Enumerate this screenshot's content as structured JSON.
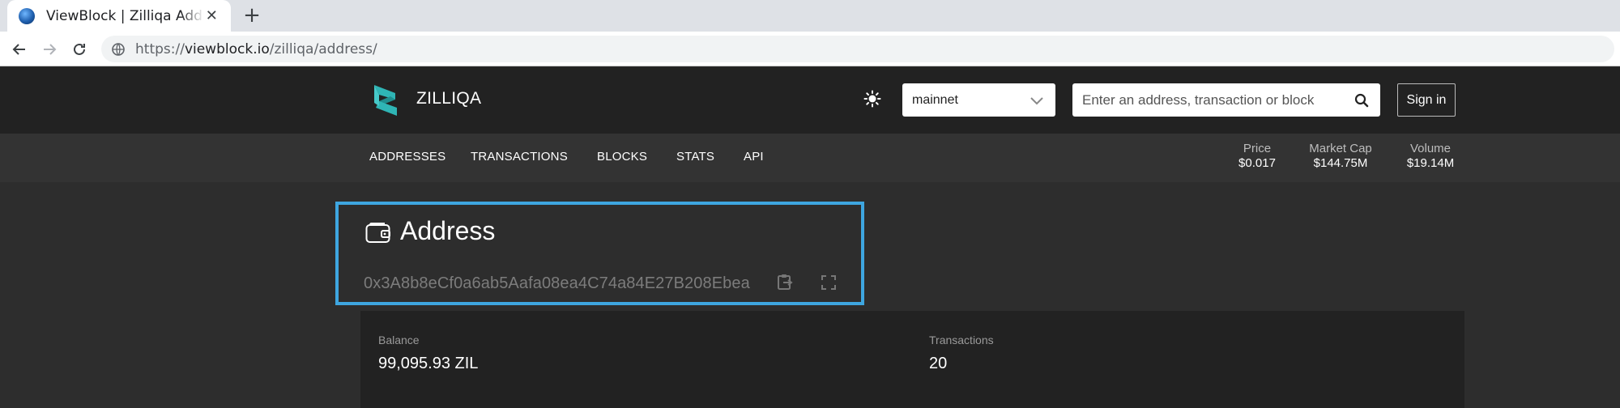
{
  "browser": {
    "tab_title": "ViewBlock | Zilliqa Address",
    "tab_close": "✕",
    "new_tab": "+",
    "url_scheme": "https://",
    "url_host": "viewblock.io",
    "url_path": "/zilliqa/address/"
  },
  "header": {
    "brand": "ZILLIQA",
    "network_selected": "mainnet",
    "search_placeholder": "Enter an address, transaction or block",
    "signin_label": "Sign in"
  },
  "nav": {
    "items": [
      {
        "label": "ADDRESSES"
      },
      {
        "label": "TRANSACTIONS"
      },
      {
        "label": "BLOCKS"
      },
      {
        "label": "STATS"
      },
      {
        "label": "API"
      }
    ],
    "stats": [
      {
        "label": "Price",
        "value": "$0.017"
      },
      {
        "label": "Market Cap",
        "value": "$144.75M"
      },
      {
        "label": "Volume",
        "value": "$19.14M"
      }
    ]
  },
  "address": {
    "title": "Address",
    "hash": "0x3A8b8eCf0a6ab5Aafa08ea4C74a84E27B208Ebea"
  },
  "summary": {
    "balance_label": "Balance",
    "balance_value": "99,095.93 ZIL",
    "transactions_label": "Transactions",
    "transactions_value": "20"
  },
  "colors": {
    "highlight": "#3ea6e0",
    "logo_teal": "#2fb5b5",
    "header_bg": "#222222",
    "nav_bg": "#333333",
    "page_bg": "#2d2d2d"
  }
}
